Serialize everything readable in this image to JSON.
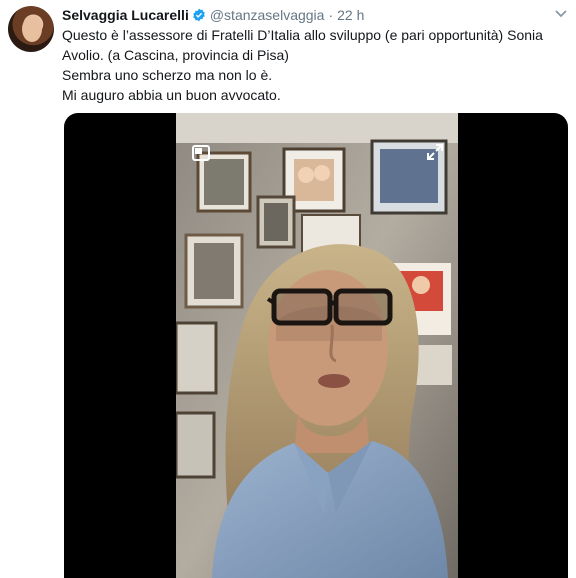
{
  "tweet": {
    "author_name": "Selvaggia Lucarelli",
    "handle": "@stanzaselvaggia",
    "separator": "·",
    "time": "22 h",
    "lines": [
      "Questo è l’assessore di Fratelli D’Italia allo sviluppo (e pari opportunità) Sonia",
      "Avolio. (a Cascina, provincia di Pisa)",
      "Sembra uno scherzo ma non lo è.",
      "Mi auguro abbia un buon avvocato."
    ]
  },
  "icons": {
    "verified": "verified-badge-icon",
    "more": "chevron-down-icon",
    "pip": "picture-in-picture-icon",
    "expand": "expand-icon"
  },
  "colors": {
    "link_blue": "#1da1f2",
    "muted_text": "#657786",
    "text": "#14171a"
  }
}
